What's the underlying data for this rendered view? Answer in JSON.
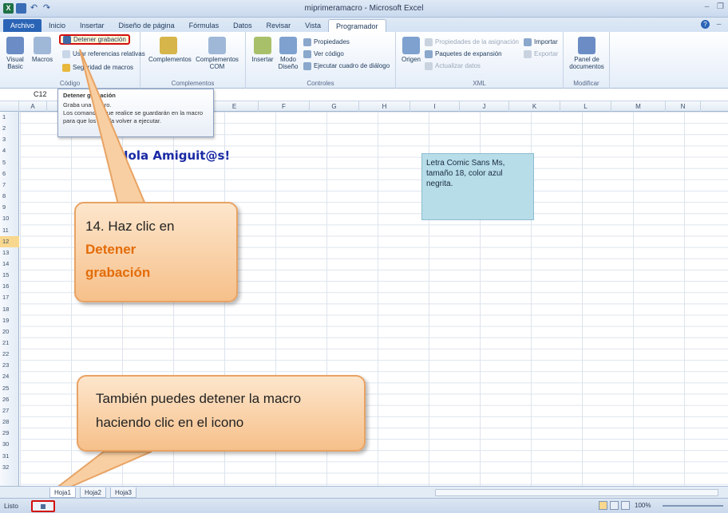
{
  "window": {
    "title": "miprimeramacro - Microsoft Excel",
    "logo_letter": "X"
  },
  "tabs": [
    "Archivo",
    "Inicio",
    "Insertar",
    "Diseño de página",
    "Fórmulas",
    "Datos",
    "Revisar",
    "Vista",
    "Programador"
  ],
  "ribbon": {
    "codigo": {
      "label": "Código",
      "visual_basic": "Visual Basic",
      "macros": "Macros",
      "stop_recording": "Detener grabación",
      "relative_refs": "Usar referencias relativas",
      "macro_security": "Seguridad de macros"
    },
    "complementos": {
      "label": "Complementos",
      "complementos": "Complementos",
      "com": "Complementos COM"
    },
    "controles": {
      "label": "Controles",
      "insertar": "Insertar",
      "modo_diseno": "Modo Diseño",
      "propiedades": "Propiedades",
      "ver_codigo": "Ver código",
      "ejecutar_cuadro": "Ejecutar cuadro de diálogo"
    },
    "xml": {
      "label": "XML",
      "origen": "Origen",
      "propiedades_asignacion": "Propiedades de la asignación",
      "paquetes": "Paquetes de expansión",
      "actualizar": "Actualizar datos",
      "importar": "Importar",
      "exportar": "Exportar"
    },
    "modificar": {
      "label": "Modificar",
      "panel": "Panel de documentos"
    }
  },
  "formula_bar": {
    "cell_ref": "C12"
  },
  "screentip": {
    "title": "Detener grabación",
    "line1": "Graba una macro.",
    "line2": "Los comandos que realice se guardarán en la macro para que los pueda volver a ejecutar."
  },
  "grid": {
    "columns": [
      "A",
      "B",
      "C",
      "D",
      "E",
      "F",
      "G",
      "H",
      "I",
      "J",
      "K",
      "L",
      "M",
      "N"
    ],
    "rows": [
      "1",
      "2",
      "3",
      "4",
      "5",
      "6",
      "7",
      "8",
      "9",
      "10",
      "11",
      "12",
      "13",
      "14",
      "15",
      "16",
      "17",
      "18",
      "19",
      "20",
      "21",
      "22",
      "23",
      "24",
      "25",
      "26",
      "27",
      "28",
      "29",
      "30",
      "31",
      "32"
    ],
    "selected_row": "12",
    "selected_col": "C",
    "cell_text": "Hola Amiguit@s!"
  },
  "note": {
    "text": "Letra Comic Sans Ms, tamaño 18, color azul negrita."
  },
  "callout1": {
    "step": "14. Haz clic en",
    "highlight1": "Detener",
    "highlight2": "grabación"
  },
  "callout2": {
    "text": "También puedes detener la macro haciendo clic en el icono"
  },
  "sheets": [
    "Hoja1",
    "Hoja2",
    "Hoja3"
  ],
  "status": {
    "state": "Listo",
    "zoom": "100%"
  },
  "colors": {
    "accent_red": "#d20f0f",
    "callout_fill": "#f6c08a",
    "note_fill": "#b7dde8",
    "text_blue": "#1a2aa5"
  }
}
